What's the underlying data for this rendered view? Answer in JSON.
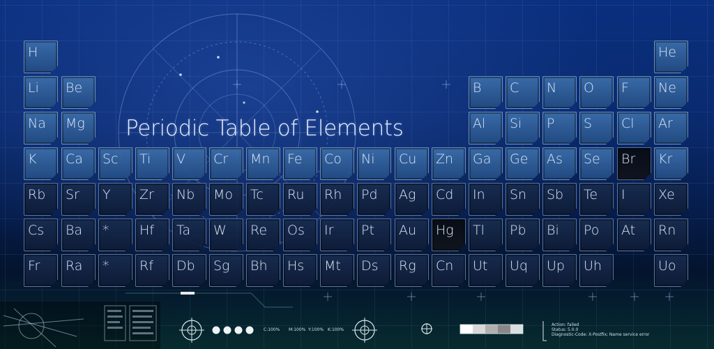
{
  "title": "Periodic Table of Elements",
  "elements": [
    {
      "s": "H",
      "r": 0,
      "c": 0,
      "style": "light"
    },
    {
      "s": "He",
      "r": 0,
      "c": 17,
      "style": "light"
    },
    {
      "s": "Li",
      "r": 1,
      "c": 0,
      "style": "light"
    },
    {
      "s": "Be",
      "r": 1,
      "c": 1,
      "style": "light"
    },
    {
      "s": "B",
      "r": 1,
      "c": 12,
      "style": "light"
    },
    {
      "s": "C",
      "r": 1,
      "c": 13,
      "style": "light"
    },
    {
      "s": "N",
      "r": 1,
      "c": 14,
      "style": "light"
    },
    {
      "s": "O",
      "r": 1,
      "c": 15,
      "style": "light"
    },
    {
      "s": "F",
      "r": 1,
      "c": 16,
      "style": "light"
    },
    {
      "s": "Ne",
      "r": 1,
      "c": 17,
      "style": "light"
    },
    {
      "s": "Na",
      "r": 2,
      "c": 0,
      "style": "light"
    },
    {
      "s": "Mg",
      "r": 2,
      "c": 1,
      "style": "light"
    },
    {
      "s": "Al",
      "r": 2,
      "c": 12,
      "style": "light"
    },
    {
      "s": "Si",
      "r": 2,
      "c": 13,
      "style": "light"
    },
    {
      "s": "P",
      "r": 2,
      "c": 14,
      "style": "light"
    },
    {
      "s": "S",
      "r": 2,
      "c": 15,
      "style": "light"
    },
    {
      "s": "Cl",
      "r": 2,
      "c": 16,
      "style": "light"
    },
    {
      "s": "Ar",
      "r": 2,
      "c": 17,
      "style": "light"
    },
    {
      "s": "K",
      "r": 3,
      "c": 0,
      "style": "light"
    },
    {
      "s": "Ca",
      "r": 3,
      "c": 1,
      "style": "light"
    },
    {
      "s": "Sc",
      "r": 3,
      "c": 2,
      "style": "light"
    },
    {
      "s": "Ti",
      "r": 3,
      "c": 3,
      "style": "light"
    },
    {
      "s": "V",
      "r": 3,
      "c": 4,
      "style": "light"
    },
    {
      "s": "Cr",
      "r": 3,
      "c": 5,
      "style": "light"
    },
    {
      "s": "Mn",
      "r": 3,
      "c": 6,
      "style": "light"
    },
    {
      "s": "Fe",
      "r": 3,
      "c": 7,
      "style": "light"
    },
    {
      "s": "Co",
      "r": 3,
      "c": 8,
      "style": "light"
    },
    {
      "s": "Ni",
      "r": 3,
      "c": 9,
      "style": "light"
    },
    {
      "s": "Cu",
      "r": 3,
      "c": 10,
      "style": "light"
    },
    {
      "s": "Zn",
      "r": 3,
      "c": 11,
      "style": "light"
    },
    {
      "s": "Ga",
      "r": 3,
      "c": 12,
      "style": "light"
    },
    {
      "s": "Ge",
      "r": 3,
      "c": 13,
      "style": "light"
    },
    {
      "s": "As",
      "r": 3,
      "c": 14,
      "style": "light"
    },
    {
      "s": "Se",
      "r": 3,
      "c": 15,
      "style": "light"
    },
    {
      "s": "Br",
      "r": 3,
      "c": 16,
      "style": "dark"
    },
    {
      "s": "Kr",
      "r": 3,
      "c": 17,
      "style": "light"
    },
    {
      "s": "Rb",
      "r": 4,
      "c": 0,
      "style": "normal"
    },
    {
      "s": "Sr",
      "r": 4,
      "c": 1,
      "style": "normal"
    },
    {
      "s": "Y",
      "r": 4,
      "c": 2,
      "style": "normal"
    },
    {
      "s": "Zr",
      "r": 4,
      "c": 3,
      "style": "normal"
    },
    {
      "s": "Nb",
      "r": 4,
      "c": 4,
      "style": "normal"
    },
    {
      "s": "Mo",
      "r": 4,
      "c": 5,
      "style": "normal"
    },
    {
      "s": "Tc",
      "r": 4,
      "c": 6,
      "style": "normal"
    },
    {
      "s": "Ru",
      "r": 4,
      "c": 7,
      "style": "normal"
    },
    {
      "s": "Rh",
      "r": 4,
      "c": 8,
      "style": "normal"
    },
    {
      "s": "Pd",
      "r": 4,
      "c": 9,
      "style": "normal"
    },
    {
      "s": "Ag",
      "r": 4,
      "c": 10,
      "style": "normal"
    },
    {
      "s": "Cd",
      "r": 4,
      "c": 11,
      "style": "normal"
    },
    {
      "s": "In",
      "r": 4,
      "c": 12,
      "style": "normal"
    },
    {
      "s": "Sn",
      "r": 4,
      "c": 13,
      "style": "normal"
    },
    {
      "s": "Sb",
      "r": 4,
      "c": 14,
      "style": "normal"
    },
    {
      "s": "Te",
      "r": 4,
      "c": 15,
      "style": "normal"
    },
    {
      "s": "I",
      "r": 4,
      "c": 16,
      "style": "normal"
    },
    {
      "s": "Xe",
      "r": 4,
      "c": 17,
      "style": "normal"
    },
    {
      "s": "Cs",
      "r": 5,
      "c": 0,
      "style": "normal"
    },
    {
      "s": "Ba",
      "r": 5,
      "c": 1,
      "style": "normal"
    },
    {
      "s": "*",
      "r": 5,
      "c": 2,
      "style": "normal"
    },
    {
      "s": "Hf",
      "r": 5,
      "c": 3,
      "style": "normal"
    },
    {
      "s": "Ta",
      "r": 5,
      "c": 4,
      "style": "normal"
    },
    {
      "s": "W",
      "r": 5,
      "c": 5,
      "style": "normal"
    },
    {
      "s": "Re",
      "r": 5,
      "c": 6,
      "style": "normal"
    },
    {
      "s": "Os",
      "r": 5,
      "c": 7,
      "style": "normal"
    },
    {
      "s": "Ir",
      "r": 5,
      "c": 8,
      "style": "normal"
    },
    {
      "s": "Pt",
      "r": 5,
      "c": 9,
      "style": "normal"
    },
    {
      "s": "Au",
      "r": 5,
      "c": 10,
      "style": "normal"
    },
    {
      "s": "Hg",
      "r": 5,
      "c": 11,
      "style": "dark"
    },
    {
      "s": "Tl",
      "r": 5,
      "c": 12,
      "style": "normal"
    },
    {
      "s": "Pb",
      "r": 5,
      "c": 13,
      "style": "normal"
    },
    {
      "s": "Bi",
      "r": 5,
      "c": 14,
      "style": "normal"
    },
    {
      "s": "Po",
      "r": 5,
      "c": 15,
      "style": "normal"
    },
    {
      "s": "At",
      "r": 5,
      "c": 16,
      "style": "normal"
    },
    {
      "s": "Rn",
      "r": 5,
      "c": 17,
      "style": "normal"
    },
    {
      "s": "Fr",
      "r": 6,
      "c": 0,
      "style": "normal"
    },
    {
      "s": "Ra",
      "r": 6,
      "c": 1,
      "style": "normal"
    },
    {
      "s": "*",
      "r": 6,
      "c": 2,
      "style": "normal"
    },
    {
      "s": "Rf",
      "r": 6,
      "c": 3,
      "style": "normal"
    },
    {
      "s": "Db",
      "r": 6,
      "c": 4,
      "style": "normal"
    },
    {
      "s": "Sg",
      "r": 6,
      "c": 5,
      "style": "normal"
    },
    {
      "s": "Bh",
      "r": 6,
      "c": 6,
      "style": "normal"
    },
    {
      "s": "Hs",
      "r": 6,
      "c": 7,
      "style": "normal"
    },
    {
      "s": "Mt",
      "r": 6,
      "c": 8,
      "style": "normal"
    },
    {
      "s": "Ds",
      "r": 6,
      "c": 9,
      "style": "normal"
    },
    {
      "s": "Rg",
      "r": 6,
      "c": 10,
      "style": "normal"
    },
    {
      "s": "Cn",
      "r": 6,
      "c": 11,
      "style": "normal"
    },
    {
      "s": "Ut",
      "r": 6,
      "c": 12,
      "style": "normal"
    },
    {
      "s": "Uq",
      "r": 6,
      "c": 13,
      "style": "normal"
    },
    {
      "s": "Up",
      "r": 6,
      "c": 14,
      "style": "normal"
    },
    {
      "s": "Uh",
      "r": 6,
      "c": 15,
      "style": "normal"
    },
    {
      "s": "Uo",
      "r": 6,
      "c": 17,
      "style": "normal"
    }
  ],
  "footer": {
    "cmyk": {
      "c": "C:100%",
      "m": "M:100%",
      "y": "Y:100%",
      "k": "K:100%"
    },
    "status": {
      "action": "Action: failed",
      "status": "Status: 5.0.0",
      "diagnostic": "Diagnostic-Code: X-Postfix; Name service error"
    }
  },
  "colors": {
    "accent": "#dbe6f5",
    "panel": "#1a2f55",
    "bg_top": "#0a2f7e",
    "bg_bottom": "#062b2e"
  }
}
